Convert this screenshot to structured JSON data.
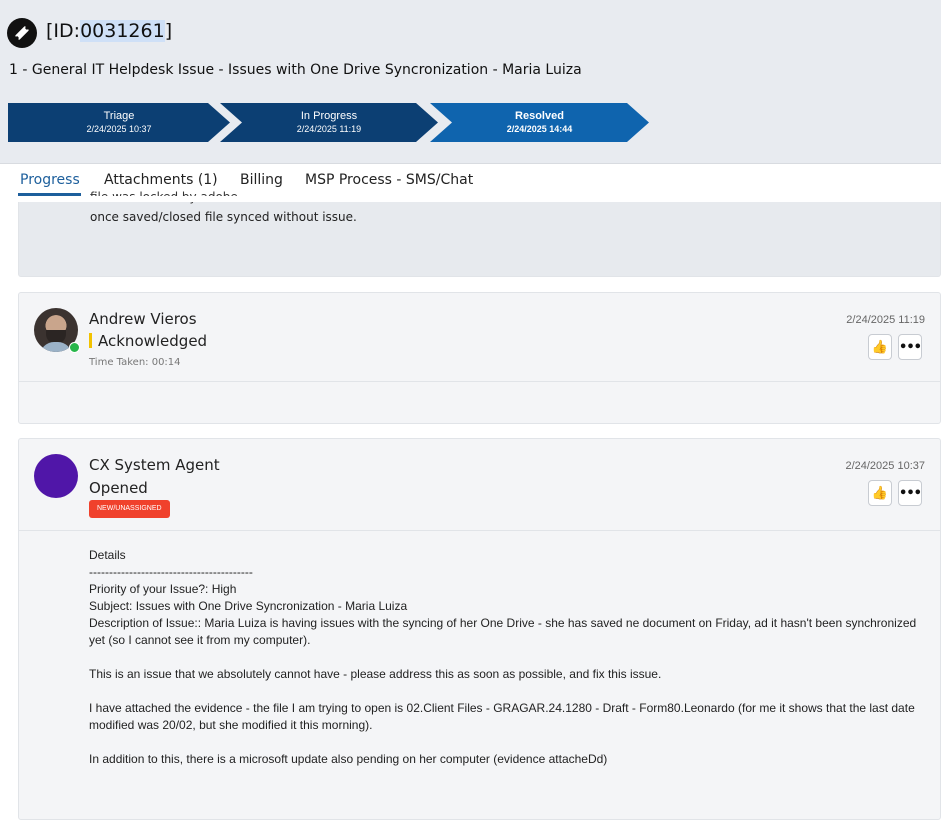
{
  "header": {
    "ticket_id_prefix": "[ID:",
    "ticket_id_number": "0031261",
    "ticket_id_suffix": "]",
    "ticket_title": "1 - General IT Helpdesk Issue - Issues with One Drive Syncronization - Maria Luiza"
  },
  "stages": [
    {
      "label": "Triage",
      "date": "2/24/2025 10:37"
    },
    {
      "label": "In Progress",
      "date": "2/24/2025 11:19"
    },
    {
      "label": "Resolved",
      "date": "2/24/2025 14:44"
    }
  ],
  "tabs": [
    "Progress",
    "Attachments (1)",
    "Billing",
    "MSP Process - SMS/Chat"
  ],
  "top_card": {
    "cut_line": "file was locked by adobe",
    "line2": "once saved/closed file synced without issue."
  },
  "entry_andrew": {
    "author": "Andrew Vieros",
    "status": "Acknowledged",
    "time_taken": "Time Taken: 00:14",
    "timestamp": "2/24/2025 11:19"
  },
  "entry_cx": {
    "author": "CX System Agent",
    "status": "Opened",
    "badge": "NEW/UNASSIGNED",
    "timestamp": "2/24/2025 10:37",
    "details": {
      "heading": "Details",
      "separator": "-----------------------------------------",
      "priority": "Priority of your Issue?: High",
      "subject": "Subject: Issues with One Drive Syncronization - Maria Luiza",
      "description": "Description of Issue:: Maria Luiza is having issues with the syncing of her One Drive - she has saved ne document on Friday, ad it hasn't been synchronized yet (so I cannot see it from my computer).",
      "para2": "This is an issue that we absolutely cannot have - please address this as soon as possible, and fix this issue.",
      "para3": "I have attached the evidence - the file I am trying to open is 02.Client Files - GRAGAR.24.1280 - Draft - Form80.Leonardo (for me it shows that the last date modified was 20/02, but she modified it this morning).",
      "para4": "In addition to this, there is a microsoft update also pending on her computer (evidence attacheDd)"
    }
  },
  "icons": {
    "ticket": "ticket-icon",
    "like": "thumbs-up-icon",
    "more": "more-options-icon"
  },
  "colors": {
    "stage_dark": "#0c3f73",
    "stage_active": "#0f64ae",
    "tab_active": "#1d5f9c",
    "badge_red": "#f0412c",
    "status_yellow": "#f2c200",
    "online_green": "#27b64a",
    "agent_purple": "#5016a8"
  }
}
